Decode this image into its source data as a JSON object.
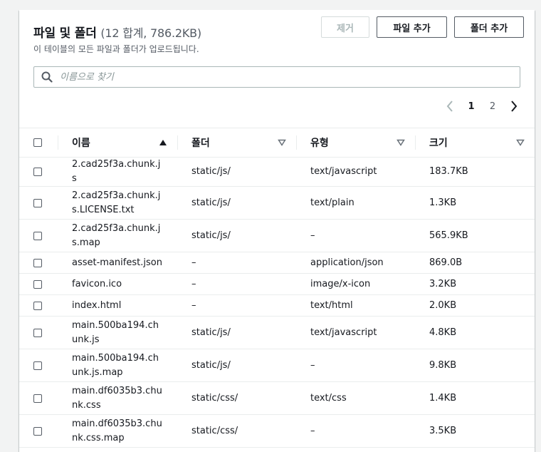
{
  "panel": {
    "title": "파일 및 폴더",
    "count_label": "(12 합계, 786.2KB)",
    "description": "이 테이블의 모든 파일과 폴더가 업로드됩니다."
  },
  "actions": {
    "remove_label": "제거",
    "add_files_label": "파일 추가",
    "add_folder_label": "폴더 추가"
  },
  "search": {
    "placeholder": "이름으로 찾기",
    "icon": "search-icon"
  },
  "pagination": {
    "pages": [
      "1",
      "2"
    ],
    "current_page": "1"
  },
  "table": {
    "columns": {
      "name": "이름",
      "folder": "폴더",
      "type": "유형",
      "size": "크기"
    },
    "rows": [
      {
        "name": "2.cad25f3a.chunk.js",
        "folder": "static/js/",
        "type": "text/javascript",
        "size": "183.7KB"
      },
      {
        "name": "2.cad25f3a.chunk.js.LICENSE.txt",
        "folder": "static/js/",
        "type": "text/plain",
        "size": "1.3KB"
      },
      {
        "name": "2.cad25f3a.chunk.js.map",
        "folder": "static/js/",
        "type": "–",
        "size": "565.9KB"
      },
      {
        "name": "asset-manifest.json",
        "folder": "–",
        "type": "application/json",
        "size": "869.0B"
      },
      {
        "name": "favicon.ico",
        "folder": "–",
        "type": "image/x-icon",
        "size": "3.2KB"
      },
      {
        "name": "index.html",
        "folder": "–",
        "type": "text/html",
        "size": "2.0KB"
      },
      {
        "name": "main.500ba194.chunk.js",
        "folder": "static/js/",
        "type": "text/javascript",
        "size": "4.8KB"
      },
      {
        "name": "main.500ba194.chunk.js.map",
        "folder": "static/js/",
        "type": "–",
        "size": "9.8KB"
      },
      {
        "name": "main.df6035b3.chunk.css",
        "folder": "static/css/",
        "type": "text/css",
        "size": "1.4KB"
      },
      {
        "name": "main.df6035b3.chunk.css.map",
        "folder": "static/css/",
        "type": "–",
        "size": "3.5KB"
      }
    ]
  },
  "colors": {
    "text": "#16191f",
    "secondary_text": "#545b64",
    "border": "#eaeded",
    "background": "#f2f3f3"
  }
}
